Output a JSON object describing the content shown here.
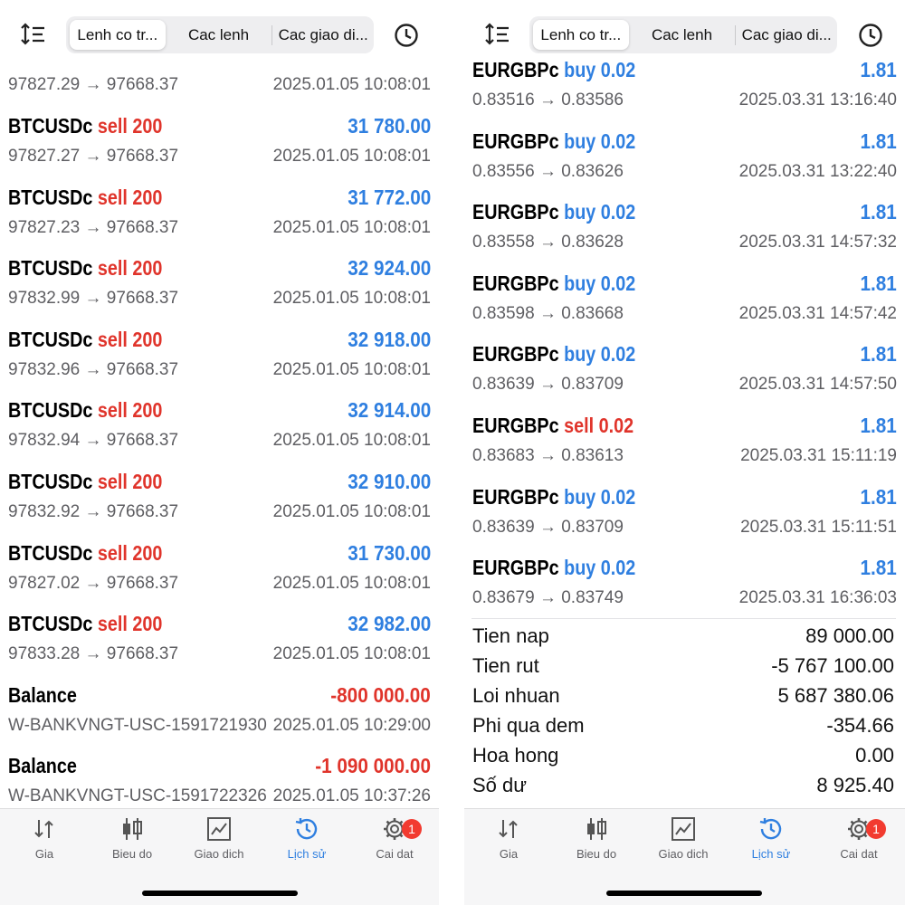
{
  "tabs": [
    "Lenh co tr...",
    "Cac lenh",
    "Cac giao di..."
  ],
  "nav": [
    {
      "label": "Gia",
      "icon": "price-arrows-icon"
    },
    {
      "label": "Bieu do",
      "icon": "candlestick-icon"
    },
    {
      "label": "Giao dich",
      "icon": "trade-chart-icon"
    },
    {
      "label": "Lịch sử",
      "icon": "history-clock-icon"
    },
    {
      "label": "Cai dat",
      "icon": "gear-icon"
    }
  ],
  "active_nav": "Lịch sử",
  "settings_badge": "1",
  "colors": {
    "sell": "#e0342b",
    "buy": "#2f7fe0",
    "accent": "#2f7fe0",
    "badge": "#f23b30"
  },
  "left": {
    "partial_top": {
      "prices": "97827.29 → 97668.37",
      "time": "2025.01.05 10:08:01"
    },
    "rows": [
      {
        "symbol": "BTCUSDc",
        "action": "sell 200",
        "profit": "31 780.00",
        "prices": "97827.27 → 97668.37",
        "time": "2025.01.05 10:08:01"
      },
      {
        "symbol": "BTCUSDc",
        "action": "sell 200",
        "profit": "31 772.00",
        "prices": "97827.23 → 97668.37",
        "time": "2025.01.05 10:08:01"
      },
      {
        "symbol": "BTCUSDc",
        "action": "sell 200",
        "profit": "32 924.00",
        "prices": "97832.99 → 97668.37",
        "time": "2025.01.05 10:08:01"
      },
      {
        "symbol": "BTCUSDc",
        "action": "sell 200",
        "profit": "32 918.00",
        "prices": "97832.96 → 97668.37",
        "time": "2025.01.05 10:08:01"
      },
      {
        "symbol": "BTCUSDc",
        "action": "sell 200",
        "profit": "32 914.00",
        "prices": "97832.94 → 97668.37",
        "time": "2025.01.05 10:08:01"
      },
      {
        "symbol": "BTCUSDc",
        "action": "sell 200",
        "profit": "32 910.00",
        "prices": "97832.92 → 97668.37",
        "time": "2025.01.05 10:08:01"
      },
      {
        "symbol": "BTCUSDc",
        "action": "sell 200",
        "profit": "31 730.00",
        "prices": "97827.02 → 97668.37",
        "time": "2025.01.05 10:08:01"
      },
      {
        "symbol": "BTCUSDc",
        "action": "sell 200",
        "profit": "32 982.00",
        "prices": "97833.28 → 97668.37",
        "time": "2025.01.05 10:08:01"
      },
      {
        "symbol": "Balance",
        "action": "",
        "profit": "-800 000.00",
        "prices": "W-BANKVNGT-USC-1591721930",
        "time": "2025.01.05 10:29:00"
      },
      {
        "symbol": "Balance",
        "action": "",
        "profit": "-1 090 000.00",
        "prices": "W-BANKVNGT-USC-1591722326",
        "time": "2025.01.05 10:37:26"
      }
    ]
  },
  "right": {
    "rows": [
      {
        "symbol": "EURGBPc",
        "action": "buy 0.02",
        "side": "buy",
        "profit": "1.81",
        "prices": "0.83516 → 0.83586",
        "time": "2025.03.31 13:16:40"
      },
      {
        "symbol": "EURGBPc",
        "action": "buy 0.02",
        "side": "buy",
        "profit": "1.81",
        "prices": "0.83556 → 0.83626",
        "time": "2025.03.31 13:22:40"
      },
      {
        "symbol": "EURGBPc",
        "action": "buy 0.02",
        "side": "buy",
        "profit": "1.81",
        "prices": "0.83558 → 0.83628",
        "time": "2025.03.31 14:57:32"
      },
      {
        "symbol": "EURGBPc",
        "action": "buy 0.02",
        "side": "buy",
        "profit": "1.81",
        "prices": "0.83598 → 0.83668",
        "time": "2025.03.31 14:57:42"
      },
      {
        "symbol": "EURGBPc",
        "action": "buy 0.02",
        "side": "buy",
        "profit": "1.81",
        "prices": "0.83639 → 0.83709",
        "time": "2025.03.31 14:57:50"
      },
      {
        "symbol": "EURGBPc",
        "action": "sell 0.02",
        "side": "sell",
        "profit": "1.81",
        "prices": "0.83683 → 0.83613",
        "time": "2025.03.31 15:11:19"
      },
      {
        "symbol": "EURGBPc",
        "action": "buy 0.02",
        "side": "buy",
        "profit": "1.81",
        "prices": "0.83639 → 0.83709",
        "time": "2025.03.31 15:11:51"
      },
      {
        "symbol": "EURGBPc",
        "action": "buy 0.02",
        "side": "buy",
        "profit": "1.81",
        "prices": "0.83679 → 0.83749",
        "time": "2025.03.31 16:36:03"
      }
    ],
    "summary": [
      {
        "label": "Tien nap",
        "value": "89 000.00"
      },
      {
        "label": "Tien rut",
        "value": "-5 767 100.00"
      },
      {
        "label": "Loi nhuan",
        "value": "5 687 380.06"
      },
      {
        "label": "Phi qua dem",
        "value": "-354.66"
      },
      {
        "label": "Hoa hong",
        "value": "0.00"
      },
      {
        "label": "Số dư",
        "value": "8 925.40"
      }
    ]
  }
}
